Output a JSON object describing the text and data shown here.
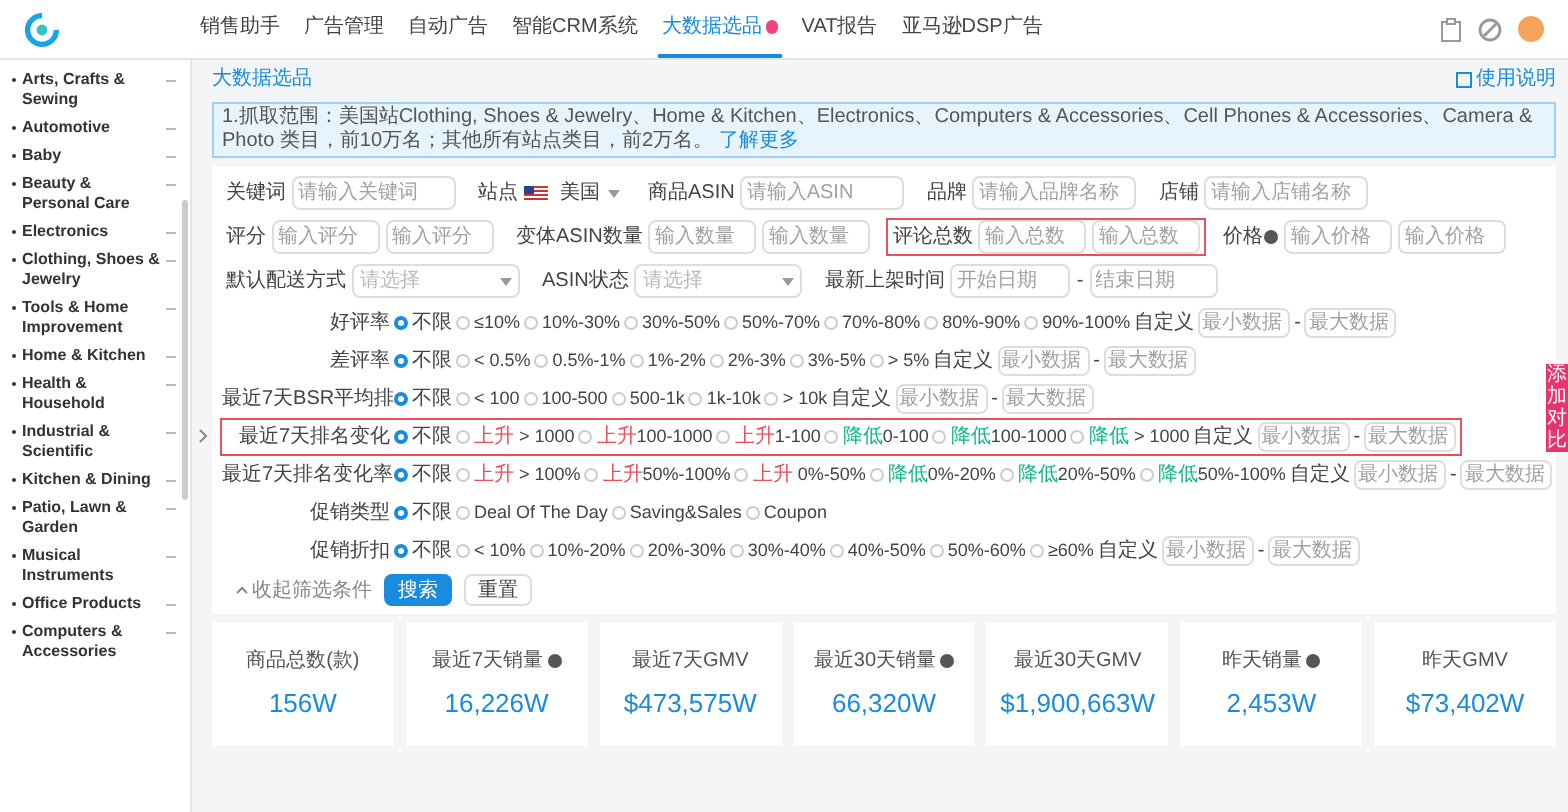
{
  "header": {
    "nav": [
      {
        "label": "销售助手",
        "selected": false,
        "badge": false
      },
      {
        "label": "广告管理",
        "selected": false,
        "badge": false
      },
      {
        "label": "自动广告",
        "selected": false,
        "badge": false
      },
      {
        "label": "智能CRM系统",
        "selected": false,
        "badge": false
      },
      {
        "label": "大数据选品",
        "selected": true,
        "badge": true
      },
      {
        "label": "VAT报告",
        "selected": false,
        "badge": false
      },
      {
        "label": "亚马逊DSP广告",
        "selected": false,
        "badge": false
      }
    ]
  },
  "sidebar": {
    "items": [
      {
        "label": "Arts, Crafts & Sewing"
      },
      {
        "label": "Automotive"
      },
      {
        "label": "Baby"
      },
      {
        "label": "Beauty & Personal Care"
      },
      {
        "label": "Electronics"
      },
      {
        "label": "Clothing, Shoes & Jewelry"
      },
      {
        "label": "Tools & Home Improvement"
      },
      {
        "label": "Home & Kitchen"
      },
      {
        "label": "Health & Household"
      },
      {
        "label": "Industrial & Scientific"
      },
      {
        "label": "Kitchen & Dining"
      },
      {
        "label": "Patio, Lawn & Garden"
      },
      {
        "label": "Musical Instruments"
      },
      {
        "label": "Office Products"
      },
      {
        "label": "Computers & Accessories"
      }
    ]
  },
  "breadcrumb": "大数据选品",
  "help_link": "使用说明",
  "notice": {
    "text": "1.抓取范围：美国站Clothing, Shoes & Jewelry、Home & Kitchen、Electronics、Computers & Accessories、Cell Phones & Accessories、Camera & Photo 类目，前10万名；其他所有站点类目，前2万名。",
    "link": "了解更多"
  },
  "field_rows": [
    [
      {
        "kind": "text",
        "label": "关键词",
        "placeholder": "请输入关键词",
        "highlighted": false
      },
      {
        "kind": "site",
        "label": "站点",
        "value": "美国",
        "highlighted": false
      },
      {
        "kind": "text",
        "label": "商品ASIN",
        "placeholder": "请输入ASIN",
        "highlighted": false
      },
      {
        "kind": "text",
        "label": "品牌",
        "placeholder": "请输入品牌名称",
        "highlighted": false
      },
      {
        "kind": "text",
        "label": "店铺",
        "placeholder": "请输入店铺名称",
        "highlighted": false
      }
    ],
    [
      {
        "kind": "range",
        "label": "评分",
        "placeholders": [
          "输入评分",
          "输入评分"
        ],
        "highlighted": false
      },
      {
        "kind": "range",
        "label": "变体ASIN数量",
        "placeholders": [
          "输入数量",
          "输入数量"
        ],
        "highlighted": false
      },
      {
        "kind": "range",
        "label": "评论总数",
        "placeholders": [
          "输入总数",
          "输入总数"
        ],
        "highlighted": true
      },
      {
        "kind": "range",
        "label": "价格",
        "help": true,
        "placeholders": [
          "输入价格",
          "输入价格"
        ],
        "highlighted": false
      }
    ],
    [
      {
        "kind": "select",
        "label": "默认配送方式",
        "placeholder": "请选择",
        "highlighted": false
      },
      {
        "kind": "select",
        "label": "ASIN状态",
        "placeholder": "请选择",
        "highlighted": false
      },
      {
        "kind": "date_range",
        "label": "最新上架时间",
        "placeholders": [
          "开始日期",
          "结束日期"
        ],
        "separator": "-",
        "highlighted": false
      }
    ]
  ],
  "radio_rows": [
    {
      "label": "好评率",
      "highlighted": false,
      "options": [
        {
          "text": "不限",
          "selected": true
        },
        {
          "text": "≤10%",
          "selected": false
        },
        {
          "text": "10%-30%",
          "selected": false
        },
        {
          "text": "30%-50%",
          "selected": false
        },
        {
          "text": "50%-70%",
          "selected": false
        },
        {
          "text": "70%-80%",
          "selected": false
        },
        {
          "text": "80%-90%",
          "selected": false
        },
        {
          "text": "90%-100%",
          "selected": false
        }
      ],
      "custom": {
        "label": "自定义",
        "placeholders": [
          "最小数据",
          "最大数据"
        ],
        "separator": "-"
      }
    },
    {
      "label": "差评率",
      "highlighted": false,
      "options": [
        {
          "text": "不限",
          "selected": true
        },
        {
          "text": "< 0.5%",
          "selected": false
        },
        {
          "text": "0.5%-1%",
          "selected": false
        },
        {
          "text": "1%-2%",
          "selected": false
        },
        {
          "text": "2%-3%",
          "selected": false
        },
        {
          "text": "3%-5%",
          "selected": false
        },
        {
          "text": "> 5%",
          "selected": false
        }
      ],
      "custom": {
        "label": "自定义",
        "placeholders": [
          "最小数据",
          "最大数据"
        ],
        "separator": "-"
      }
    },
    {
      "label": "最近7天BSR平均排",
      "highlighted": false,
      "options": [
        {
          "text": "不限",
          "selected": true
        },
        {
          "text": "< 100",
          "selected": false
        },
        {
          "text": "100-500",
          "selected": false
        },
        {
          "text": "500-1k",
          "selected": false
        },
        {
          "text": "1k-10k",
          "selected": false
        },
        {
          "text": "> 10k",
          "selected": false
        }
      ],
      "custom": {
        "label": "自定义",
        "placeholders": [
          "最小数据",
          "最大数据"
        ],
        "separator": "-"
      }
    },
    {
      "label": "最近7天排名变化",
      "highlighted": true,
      "options": [
        {
          "text": "不限",
          "selected": true
        },
        {
          "color": "#e8505b",
          "prefix": "上升",
          "text": " > 1000",
          "selected": false
        },
        {
          "color": "#e8505b",
          "prefix": "上升",
          "text": "100-1000",
          "selected": false
        },
        {
          "color": "#e8505b",
          "prefix": "上升",
          "text": "1-100",
          "selected": false
        },
        {
          "color": "#12b886",
          "prefix": "降低",
          "text": "0-100",
          "selected": false
        },
        {
          "color": "#12b886",
          "prefix": "降低",
          "text": "100-1000",
          "selected": false
        },
        {
          "color": "#12b886",
          "prefix": "降低",
          "text": " > 1000",
          "selected": false
        }
      ],
      "custom": {
        "label": "自定义",
        "placeholders": [
          "最小数据",
          "最大数据"
        ],
        "separator": "-"
      }
    },
    {
      "label": "最近7天排名变化率",
      "highlighted": false,
      "options": [
        {
          "text": "不限",
          "selected": true
        },
        {
          "color": "#e8505b",
          "prefix": "上升",
          "text": " > 100%",
          "selected": false
        },
        {
          "color": "#e8505b",
          "prefix": "上升",
          "text": "50%-100%",
          "selected": false
        },
        {
          "color": "#e8505b",
          "prefix": "上升",
          "text": " 0%-50%",
          "selected": false
        },
        {
          "color": "#12b886",
          "prefix": "降低",
          "text": "0%-20%",
          "selected": false
        },
        {
          "color": "#12b886",
          "prefix": "降低",
          "text": "20%-50%",
          "selected": false
        },
        {
          "color": "#12b886",
          "prefix": "降低",
          "text": "50%-100%",
          "selected": false
        }
      ],
      "custom": {
        "label": "自定义",
        "placeholders": [
          "最小数据",
          "最大数据"
        ],
        "separator": "-"
      }
    },
    {
      "label": "促销类型",
      "highlighted": false,
      "options": [
        {
          "text": "不限",
          "selected": true
        },
        {
          "text": "Deal Of The Day",
          "selected": false
        },
        {
          "text": "Saving&Sales",
          "selected": false
        },
        {
          "text": "Coupon",
          "selected": false
        }
      ]
    },
    {
      "label": "促销折扣",
      "highlighted": false,
      "options": [
        {
          "text": "不限",
          "selected": true
        },
        {
          "text": "< 10%",
          "selected": false
        },
        {
          "text": "10%-20%",
          "selected": false
        },
        {
          "text": "20%-30%",
          "selected": false
        },
        {
          "text": "30%-40%",
          "selected": false
        },
        {
          "text": "40%-50%",
          "selected": false
        },
        {
          "text": "50%-60%",
          "selected": false
        },
        {
          "text": "≥60%",
          "selected": false
        }
      ],
      "custom": {
        "label": "自定义",
        "placeholders": [
          "最小数据",
          "最大数据"
        ],
        "separator": "-"
      }
    }
  ],
  "filter_footer": {
    "collapse": "收起筛选条件",
    "search": "搜索",
    "reset": "重置"
  },
  "compare_tab": "添加对比",
  "stats": [
    {
      "label": "商品总数(款)",
      "help": false,
      "value": "156W"
    },
    {
      "label": "最近7天销量",
      "help": true,
      "value": "16,226W"
    },
    {
      "label": "最近7天GMV",
      "help": false,
      "value": "$473,575W"
    },
    {
      "label": "最近30天销量",
      "help": true,
      "value": "66,320W"
    },
    {
      "label": "最近30天GMV",
      "help": false,
      "value": "$1,900,663W"
    },
    {
      "label": "昨天销量",
      "help": true,
      "value": "2,453W"
    },
    {
      "label": "昨天GMV",
      "help": false,
      "value": "$73,402W"
    }
  ]
}
